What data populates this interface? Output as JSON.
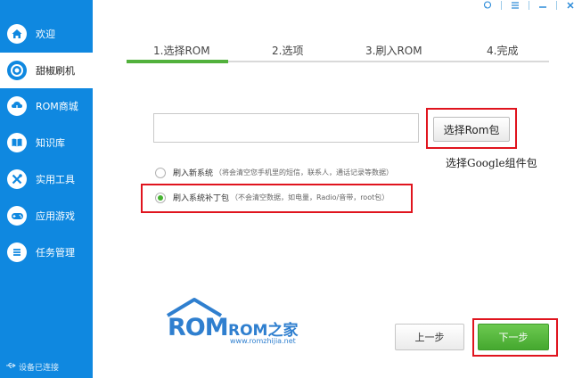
{
  "window_controls": {
    "feedback_icon": "chat-bubble-icon",
    "menu_icon": "menu-icon",
    "minimize_icon": "minimize-icon",
    "close_icon": "close-icon"
  },
  "sidebar": {
    "items": [
      {
        "label": "欢迎",
        "icon": "home-icon",
        "active": false
      },
      {
        "label": "甜椒刷机",
        "icon": "target-icon",
        "active": true
      },
      {
        "label": "ROM商城",
        "icon": "cloud-download-icon",
        "active": false
      },
      {
        "label": "知识库",
        "icon": "book-icon",
        "active": false
      },
      {
        "label": "实用工具",
        "icon": "tools-icon",
        "active": false
      },
      {
        "label": "应用游戏",
        "icon": "gamepad-icon",
        "active": false
      },
      {
        "label": "任务管理",
        "icon": "list-icon",
        "active": false
      }
    ],
    "status": "设备已连接",
    "status_icon": "usb-icon"
  },
  "steps": {
    "items": [
      "1.选择ROM",
      "2.选项",
      "3.刷入ROM",
      "4.完成"
    ],
    "active_index": 0
  },
  "package": {
    "input_value": "",
    "choose_button_label": "选择Rom包",
    "annotation": "选择Google组件包"
  },
  "options": [
    {
      "label": "刷入新系统",
      "note": "（将会清空您手机里的短信，联系人，通话记录等数据）",
      "selected": false
    },
    {
      "label": "刷入系统补丁包",
      "note": "（不会清空数据，如电量，Radio/音带，root包）",
      "selected": true
    }
  ],
  "logo": {
    "big": "ROM",
    "brand": "ROM之家",
    "url": "www.romzhijia.net"
  },
  "buttons": {
    "prev": "上一步",
    "next": "下一步"
  },
  "colors": {
    "sidebar": "#0f88e0",
    "accent_green": "#52b13c",
    "highlight_red": "#e0141e",
    "logo_blue": "#2f7fcf"
  }
}
